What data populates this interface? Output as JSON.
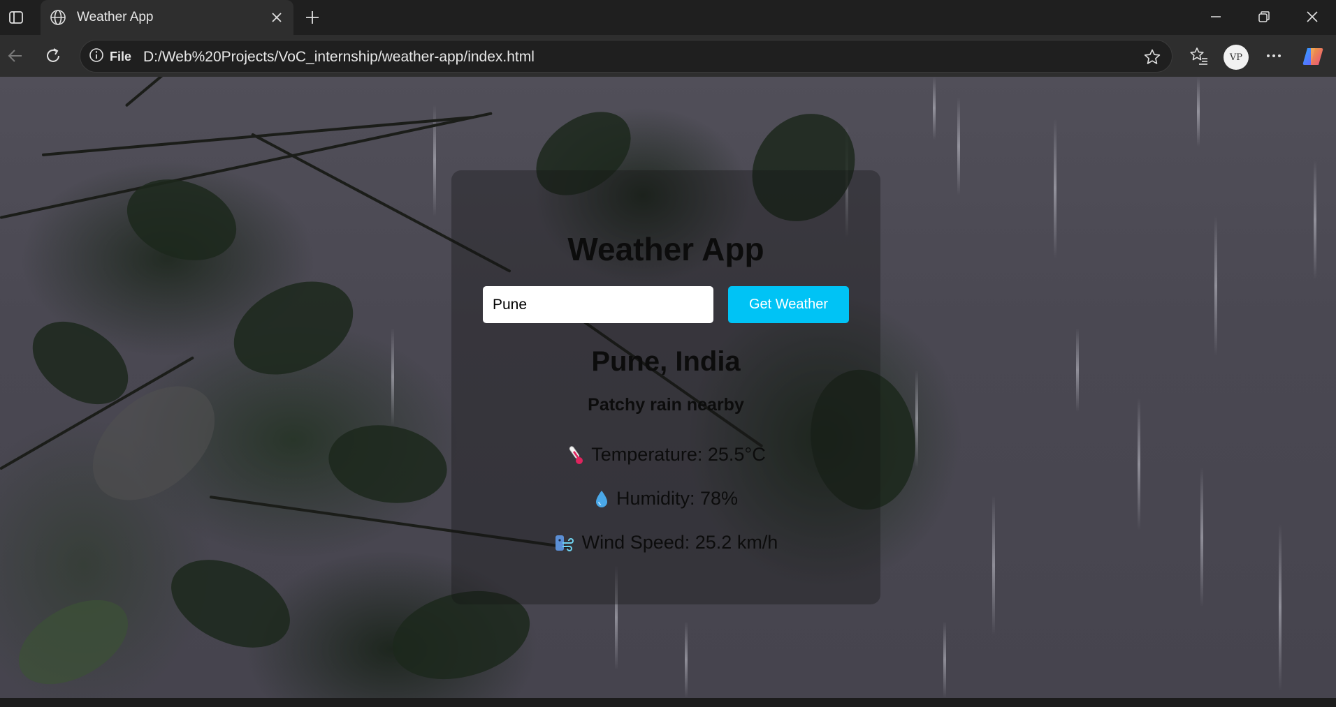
{
  "browser": {
    "tab_title": "Weather App",
    "site_info_label": "File",
    "url": "D:/Web%20Projects/VoC_internship/weather-app/index.html",
    "profile_initials": "VP"
  },
  "app": {
    "title": "Weather App",
    "search": {
      "value": "Pune",
      "button_label": "Get Weather"
    },
    "location": "Pune, India",
    "condition": "Patchy rain nearby",
    "temperature": "Temperature: 25.5°C",
    "humidity": "Humidity: 78%",
    "wind": "Wind Speed: 25.2 km/h",
    "colors": {
      "button": "#00c3f5",
      "text": "#0c0c0c"
    },
    "icons": {
      "temperature": "thermometer-icon",
      "humidity": "droplet-icon",
      "wind": "wind-icon"
    }
  }
}
